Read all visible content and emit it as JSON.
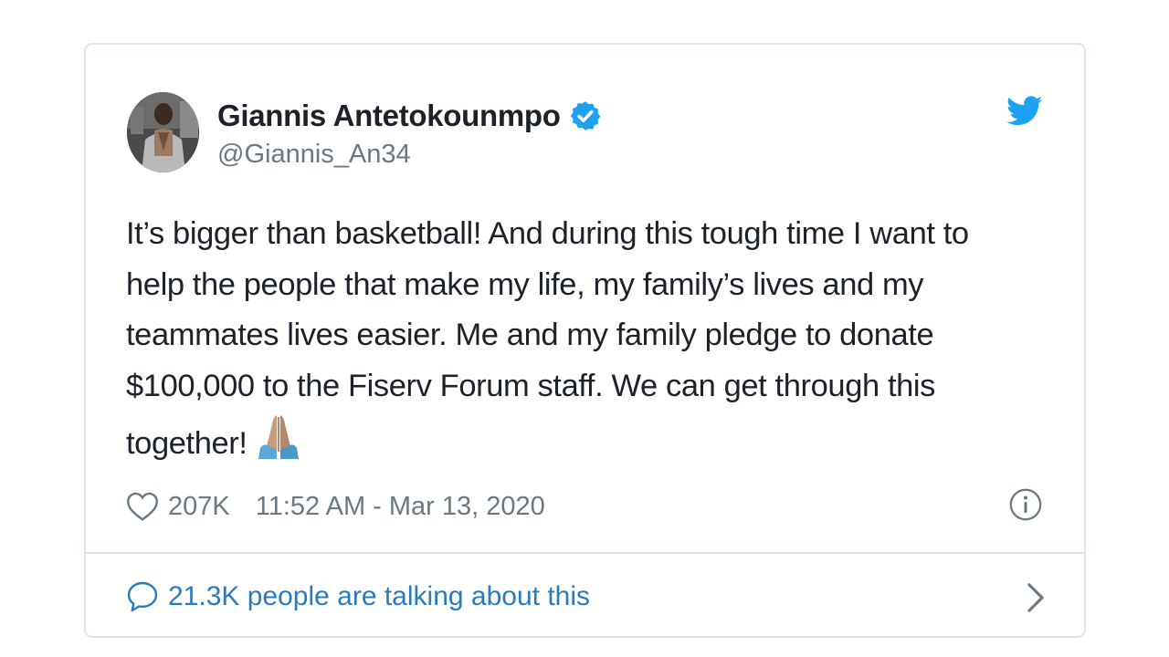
{
  "author": {
    "name": "Giannis Antetokounmpo",
    "handle": "@Giannis_An34",
    "verified": true
  },
  "tweet": {
    "text": "It’s bigger than basketball! And during this tough time I want to\nhelp the people that make my life, my family’s lives and my\nteammates lives easier. Me and my family pledge to donate\n$100,000 to the Fiserv Forum staff. We can get through this\ntogether!",
    "emoji": "folded-hands-emoji"
  },
  "meta": {
    "likes": "207K",
    "timestamp": "11:52 AM - Mar 13, 2020"
  },
  "footer": {
    "talking_label": "21.3K people are talking about this"
  },
  "icons": {
    "brand": "twitter-bird-icon",
    "verified": "verified-badge-icon",
    "like": "heart-icon",
    "info": "info-icon",
    "reply": "speech-bubble-icon",
    "more": "chevron-right-icon"
  },
  "colors": {
    "accent": "#1da1f2",
    "link": "#2b7bb9",
    "text": "#1c2228",
    "secondary": "#697882",
    "border": "#dfe5ea"
  }
}
